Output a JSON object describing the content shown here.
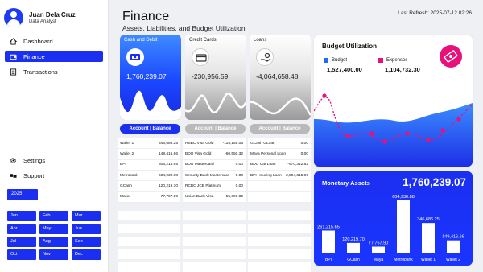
{
  "profile": {
    "name": "Juan Dela Cruz",
    "role": "Data Analyst"
  },
  "nav": {
    "items": [
      {
        "label": "Dashboard",
        "icon": "home-icon",
        "active": false
      },
      {
        "label": "Finance",
        "icon": "wallet-icon",
        "active": true
      },
      {
        "label": "Transactions",
        "icon": "list-icon",
        "active": false
      }
    ],
    "bottom": [
      {
        "label": "Settings",
        "icon": "gear-icon"
      },
      {
        "label": "Support",
        "icon": "handshake-icon"
      }
    ]
  },
  "calendar": {
    "year": "2025",
    "months": [
      "Jan",
      "Feb",
      "Mar",
      "Apr",
      "May",
      "Jun",
      "Jul",
      "Aug",
      "Sep",
      "Oct",
      "Nov",
      "Dec"
    ]
  },
  "header": {
    "title": "Finance",
    "subtitle": "Assets, Liabilities, and Budget Utilization",
    "refresh": "Last Refresh: 2025-07-12 02:26"
  },
  "cards": [
    {
      "label": "Cash and Debit",
      "value": "1,760,239.07",
      "icon": "cash-icon",
      "button": "Account | Balance"
    },
    {
      "label": "Credit Cards",
      "value": "-230,956.59",
      "icon": "credit-card-icon",
      "button": "Account | Balance"
    },
    {
      "label": "Loans",
      "value": "-4,064,658.48",
      "icon": "loan-hand-icon",
      "button": "Account | Balance"
    }
  ],
  "tables": [
    [
      [
        "Wallet 1",
        "346,686.25"
      ],
      [
        "Wallet 2",
        "149,416.66"
      ],
      [
        "BPI",
        "506,213.65"
      ],
      [
        "Metrobank",
        "604,930.88"
      ],
      [
        "GCash",
        "120,219.70"
      ],
      [
        "Maya",
        "77,767.90"
      ]
    ],
    [
      [
        "HSBC Visa Gold",
        "-115,155.05"
      ],
      [
        "BDO Visa Gold",
        "-60,550.32"
      ],
      [
        "BDO Mastercard",
        "0.00"
      ],
      [
        "Security Bank Mastercard",
        "0.00"
      ],
      [
        "RCBC JCB Platinum",
        "0.00"
      ],
      [
        "Union Bank Visa",
        "-55,601.02"
      ]
    ],
    [
      [
        "GCash GLoan",
        "0.00"
      ],
      [
        "Maya Personal Loan",
        "0.00"
      ],
      [
        "BDO Car Loan",
        "-970,342.52"
      ],
      [
        "BPI Housing Loan",
        "-3,094,315.96"
      ],
      [
        "",
        ""
      ],
      [
        "",
        ""
      ]
    ]
  ],
  "budget": {
    "title": "Budget Utilization",
    "budget_label": "Budget",
    "budget_value": "1,527,400.00",
    "expenses_label": "Expenses",
    "expenses_value": "1,104,732.30",
    "budget_color": "#1a6cff",
    "expenses_color": "#e8107a",
    "badge_icon": "money-icon"
  },
  "monetary": {
    "title": "Monetary Assets",
    "total": "1,760,239.07",
    "chart_data": {
      "type": "bar",
      "categories": [
        "BPI",
        "GCash",
        "Maya",
        "Metrobank",
        "Wallet 1",
        "Wallet 2"
      ],
      "values": [
        261215.65,
        120219.7,
        77767.9,
        604930.88,
        346686.25,
        149416.66
      ],
      "value_labels": [
        "261,215.65",
        "120,219.70",
        "77,767.90",
        "604,930.88",
        "346,686.25",
        "149,416.66"
      ]
    }
  }
}
